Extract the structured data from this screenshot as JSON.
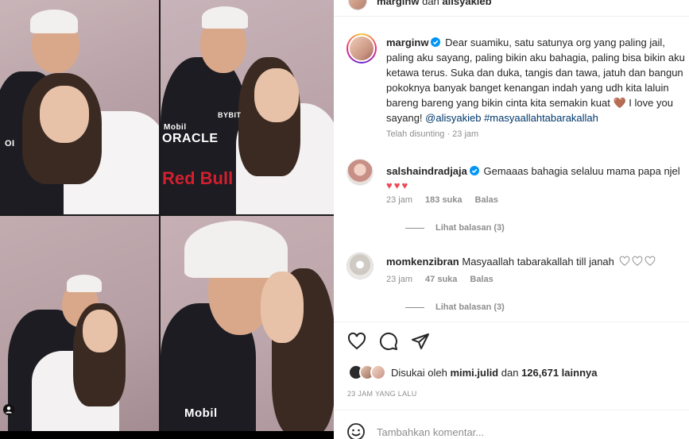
{
  "post": {
    "author": "marginw",
    "collaborator_joiner": "dan",
    "collaborator": "alisyakieb",
    "caption_lines": [
      "Dear suamiku, satu satunya org yang paling jail,",
      "paling aku sayang, paling bikin aku bahagia, paling bisa bikin aku",
      "ketawa terus. Suka dan duka, tangis dan tawa, jatuh dan bangun",
      "pokoknya banyak banget kenangan indah yang udh kita laluin",
      "bareng bareng yang bikin cinta kita semakin kuat",
      "I love you",
      "sayang!"
    ],
    "caption_heart": "🤎",
    "mention": "@alisyakieb",
    "hashtag": "#masyaallahtabarakallah",
    "edited_label": "Telah disunting · 23 jam"
  },
  "comments": [
    {
      "username": "salshaindradjaja",
      "verified": true,
      "text": "Gemaaas bahagia selaluu mama papa njel",
      "hearts": "♥♥♥",
      "time": "23 jam",
      "likes": "183 suka",
      "reply_label": "Balas",
      "view_replies": "Lihat balasan (3)"
    },
    {
      "username": "momkenzibran",
      "verified": false,
      "text": "Masyaallah tabarakallah till janah",
      "time": "23 jam",
      "likes": "47 suka",
      "reply_label": "Balas",
      "view_replies": "Lihat balasan (3)"
    }
  ],
  "likes_bar": {
    "prefix": "Disukai oleh",
    "user": "mimi.julid",
    "joiner": "dan",
    "count": "126,671 lainnya"
  },
  "time_ago": "23 JAM YANG LALU",
  "add_comment": {
    "placeholder": "Tambahkan komentar..."
  },
  "photo_text": {
    "mobil": "Mobil",
    "oracle": "ORACLE",
    "redbull": "Red Bull",
    "bybit": "BYBIT"
  },
  "colors": {
    "verified_blue": "#0095f6",
    "link_blue": "#00376b",
    "heart_red": "#ed4956",
    "muted_gray": "#8e8e8e"
  }
}
